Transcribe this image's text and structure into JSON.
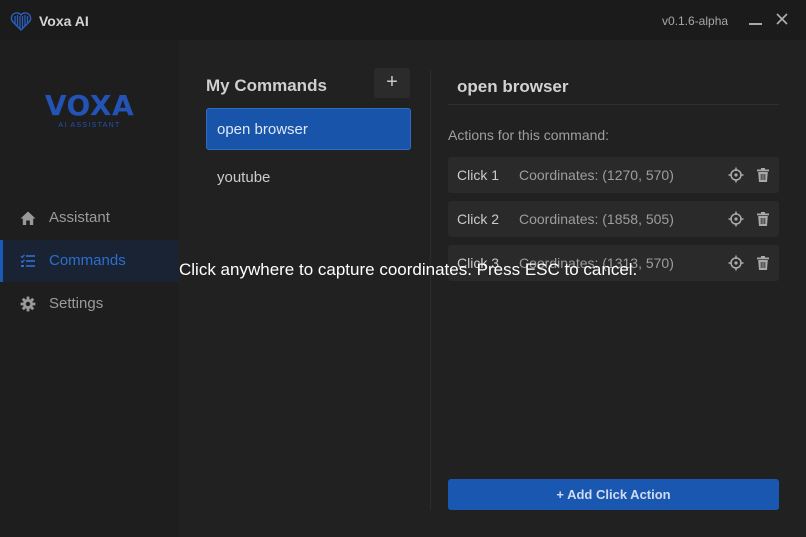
{
  "app": {
    "title": "Voxa AI",
    "version": "v0.1.6-alpha",
    "brand_name": "VOXA",
    "brand_subtitle": "AI ASSISTANT",
    "accent_color": "#1a57b0"
  },
  "sidebar": {
    "items": [
      {
        "label": "Assistant",
        "icon": "home-icon",
        "active": false
      },
      {
        "label": "Commands",
        "icon": "list-icon",
        "active": true
      },
      {
        "label": "Settings",
        "icon": "gear-icon",
        "active": false
      }
    ]
  },
  "commands": {
    "title": "My Commands",
    "add_label": "+",
    "items": [
      {
        "label": "open browser",
        "selected": true
      },
      {
        "label": "youtube",
        "selected": false
      }
    ]
  },
  "detail": {
    "title": "open browser",
    "actions_label": "Actions for this command:",
    "actions": [
      {
        "name": "Click 1",
        "coords": "Coordinates: (1270, 570)"
      },
      {
        "name": "Click 2",
        "coords": "Coordinates: (1858, 505)"
      },
      {
        "name": "Click 3",
        "coords": "Coordinates: (1313, 570)"
      }
    ],
    "add_action_label": "+ Add Click Action"
  },
  "overlay": {
    "message": "Click anywhere to capture coordinates. Press ESC to cancel."
  }
}
